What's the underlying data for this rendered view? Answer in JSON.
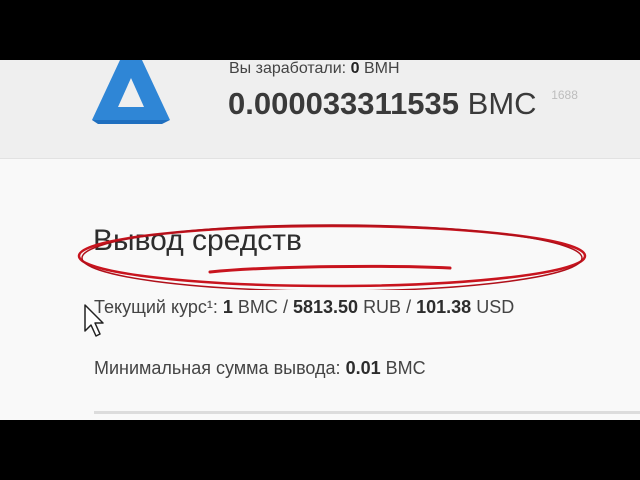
{
  "header": {
    "earned_label": "Вы заработали:",
    "earned_value": "0",
    "earned_unit": "BMH",
    "balance_value": "0.000033311535",
    "balance_unit": "BMC",
    "balance_sup": "1688"
  },
  "withdraw": {
    "title": "Вывод средств",
    "rate_label": "Текущий курс¹:",
    "rate_bmc_amount": "1",
    "rate_bmc_unit": "BMC",
    "rate_rub_amount": "5813.50",
    "rate_rub_unit": "RUB",
    "rate_usd_amount": "101.38",
    "rate_usd_unit": "USD",
    "min_label": "Минимальная сумма вывода:",
    "min_amount": "0.01",
    "min_unit": "BMC"
  },
  "colors": {
    "logo_blue": "#2f86d6",
    "annotation_red": "#c8141e"
  },
  "icons": {
    "logo": "triangle-logo-icon",
    "cursor": "mouse-pointer-icon"
  }
}
